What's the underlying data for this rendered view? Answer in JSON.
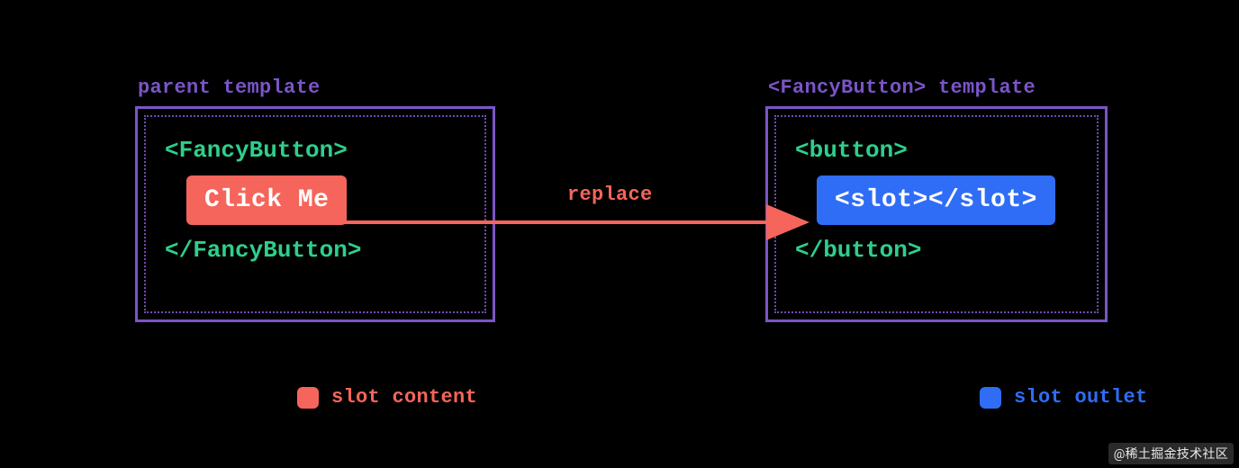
{
  "left_panel": {
    "label": "parent template",
    "open_tag": "<FancyButton>",
    "slot_content_text": "Click Me",
    "close_tag": "</FancyButton>"
  },
  "right_panel": {
    "label": "<FancyButton> template",
    "open_tag": "<button>",
    "slot_outlet_text": "<slot></slot>",
    "close_tag": "</button>"
  },
  "arrow": {
    "label": "replace"
  },
  "legend": {
    "slot_content": "slot content",
    "slot_outlet": "slot outlet"
  },
  "watermark": "@稀土掘金技术社区",
  "colors": {
    "purple": "#7a55c7",
    "green": "#2ecf8b",
    "red": "#f5655b",
    "blue": "#2f6df6",
    "bg": "#000000"
  }
}
